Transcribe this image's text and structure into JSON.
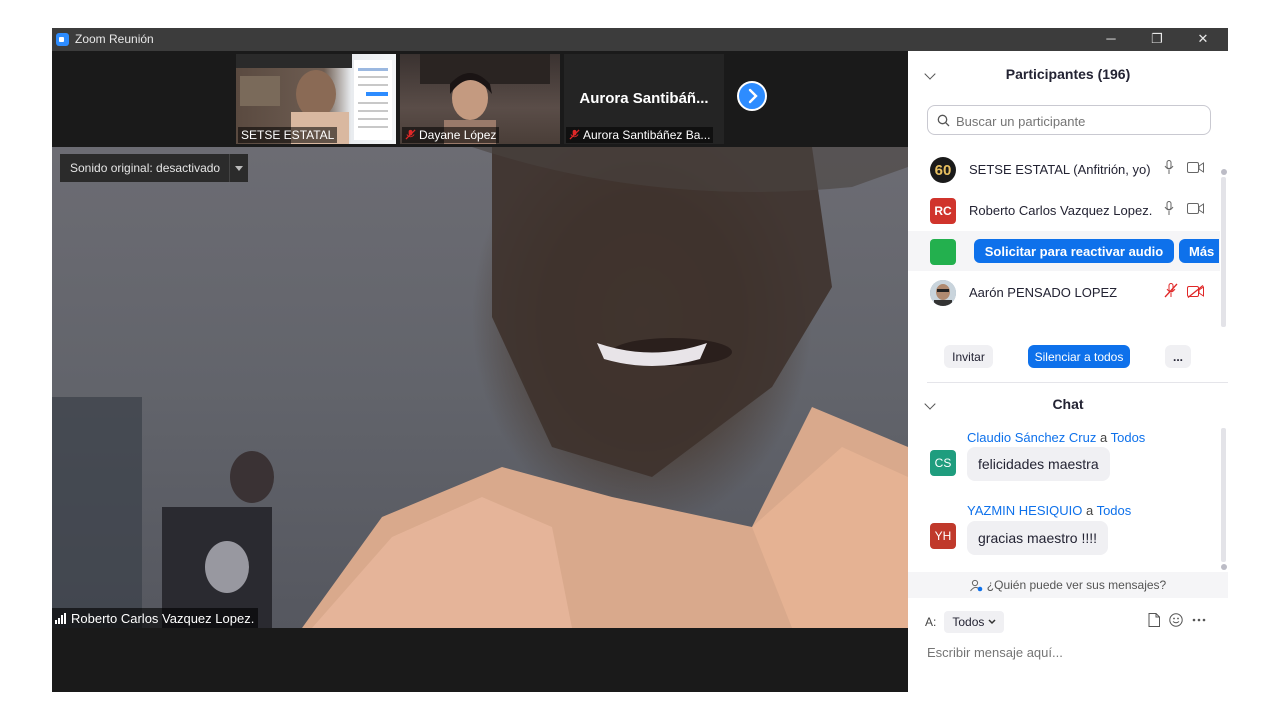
{
  "window": {
    "title": "Zoom Reunión",
    "controls": {
      "minimize": "─",
      "restore": "❐",
      "close": "✕"
    }
  },
  "thumbnails": [
    {
      "name": "SETSE ESTATAL",
      "muted": false
    },
    {
      "name": "Dayane López",
      "muted": true
    },
    {
      "name": "Aurora Santibáñez Ba...",
      "display_name": "Aurora  Santibáñ...",
      "muted": true
    }
  ],
  "main_video": {
    "original_sound_label": "Sonido original: desactivado",
    "speaker_name": "Roberto Carlos Vazquez Lopez."
  },
  "participants": {
    "header": "Participantes (196)",
    "search_placeholder": "Buscar un participante",
    "rows": [
      {
        "avatar": "60",
        "name": "SETSE ESTATAL (Anfitrión, yo)",
        "avatar_color": "#1a1a1a",
        "mic": "on",
        "cam": "on"
      },
      {
        "avatar": "RC",
        "name": "Roberto Carlos Vazquez Lopez.",
        "avatar_color": "#d0342c",
        "mic": "on",
        "cam": "on"
      },
      {
        "avatar": "",
        "name": "",
        "avatar_color": "#23b04e",
        "request_audio_label": "Solicitar para reactivar audio",
        "more_label": "Más"
      },
      {
        "avatar": "",
        "name": "Aarón PENSADO LOPEZ",
        "avatar_color": "#8aa0b4",
        "mic": "muted",
        "cam": "off"
      }
    ],
    "invite_label": "Invitar",
    "mute_all_label": "Silenciar a todos",
    "more_label": "..."
  },
  "chat": {
    "header": "Chat",
    "messages": [
      {
        "sender": "Claudio Sánchez Cruz",
        "connector": "a",
        "recipient": "Todos",
        "initials": "CS",
        "avatar_color": "#1f9d7e",
        "text": "felicidades maestra"
      },
      {
        "sender": "YAZMIN HESIQUIO",
        "connector": "a",
        "recipient": "Todos",
        "initials": "YH",
        "avatar_color": "#c0392b",
        "text": "gracias maestro !!!!"
      }
    ],
    "who_can_see": "¿Quién puede ver sus mensajes?",
    "to_label": "A:",
    "to_value": "Todos",
    "input_placeholder": "Escribir mensaje aquí..."
  },
  "colors": {
    "accent": "#0e71eb",
    "zoom_blue": "#2d8cff",
    "mute_red": "#e02828"
  },
  "icons": [
    "zoom-app-icon",
    "chevron-down-icon",
    "search-icon",
    "microphone-icon",
    "camera-icon",
    "mic-muted-icon",
    "camera-off-icon",
    "file-icon",
    "emoji-icon",
    "ellipsis-icon",
    "signal-icon",
    "next-arrow-icon",
    "person-eye-icon"
  ]
}
